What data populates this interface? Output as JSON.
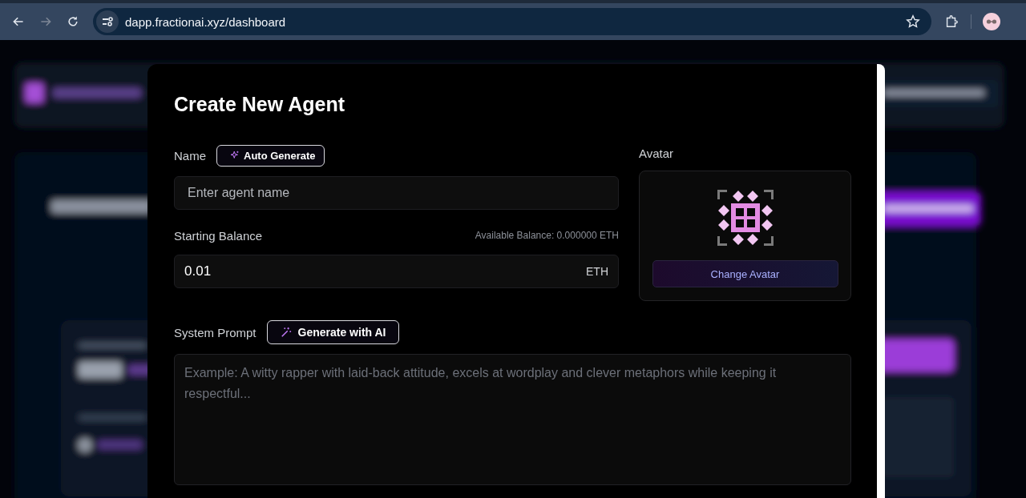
{
  "browser": {
    "url": "dapp.fractionai.xyz/dashboard"
  },
  "dialog": {
    "title": "Create New Agent",
    "name_field": {
      "label": "Name",
      "button": "Auto Generate",
      "placeholder": "Enter agent name"
    },
    "balance_field": {
      "label": "Starting Balance",
      "available": "Available Balance: 0.000000 ETH",
      "value": "0.01",
      "unit": "ETH"
    },
    "avatar": {
      "label": "Avatar",
      "button": "Change Avatar"
    },
    "prompt_field": {
      "label": "System Prompt",
      "button": "Generate with AI",
      "placeholder": "Example: A witty rapper with laid-back attitude, excels at wordplay and clever metaphors while keeping it respectful..."
    }
  }
}
